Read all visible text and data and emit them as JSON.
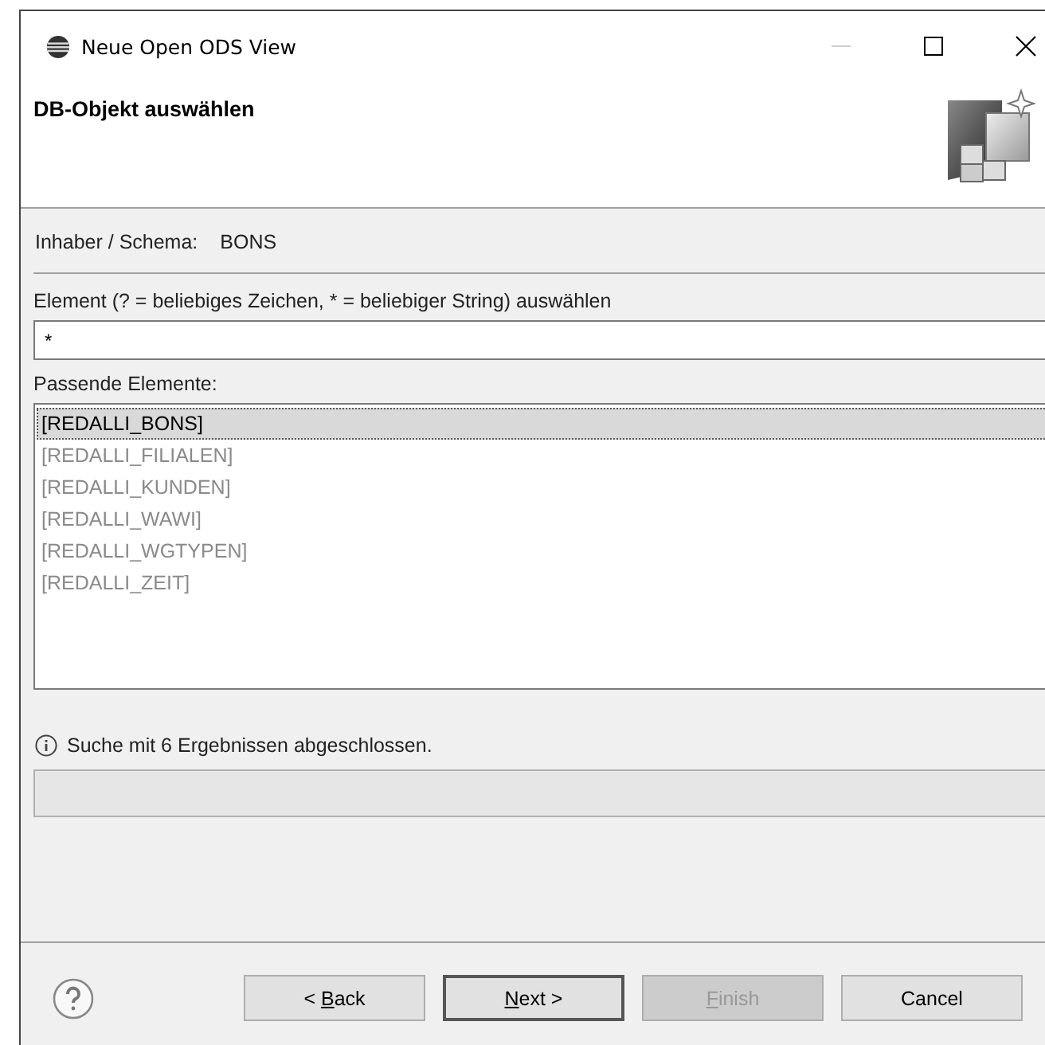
{
  "window": {
    "title": "Neue Open ODS View",
    "minimize_enabled": false
  },
  "header": {
    "title": "DB-Objekt auswählen"
  },
  "schema": {
    "label": "Inhaber / Schema:",
    "value": "BONS"
  },
  "filter": {
    "label": "Element (? = beliebiges Zeichen, * = beliebiger String) auswählen",
    "value": "*"
  },
  "matches": {
    "label": "Passende Elemente:",
    "items": [
      {
        "label": "[REDALLI_BONS]",
        "selected": true
      },
      {
        "label": "[REDALLI_FILIALEN]",
        "selected": false
      },
      {
        "label": "[REDALLI_KUNDEN]",
        "selected": false
      },
      {
        "label": "[REDALLI_WAWI]",
        "selected": false
      },
      {
        "label": "[REDALLI_WGTYPEN]",
        "selected": false
      },
      {
        "label": "[REDALLI_ZEIT]",
        "selected": false
      }
    ]
  },
  "status": {
    "text": "Suche mit 6 Ergebnissen abgeschlossen."
  },
  "buttons": [
    {
      "label_before": "< ",
      "mnemonic": "B",
      "label_after": "ack",
      "disabled": false,
      "default": false
    },
    {
      "mnemonic": "N",
      "label_after": "ext >",
      "disabled": false,
      "default": true
    },
    {
      "mnemonic": "F",
      "label_after": "inish",
      "disabled": true,
      "default": false
    },
    {
      "label_before": "Cancel",
      "disabled": false,
      "default": false
    }
  ]
}
